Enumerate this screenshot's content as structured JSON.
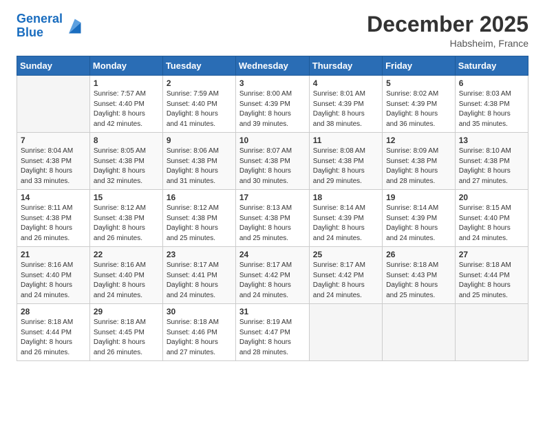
{
  "header": {
    "logo_line1": "General",
    "logo_line2": "Blue",
    "month_title": "December 2025",
    "location": "Habsheim, France"
  },
  "weekdays": [
    "Sunday",
    "Monday",
    "Tuesday",
    "Wednesday",
    "Thursday",
    "Friday",
    "Saturday"
  ],
  "weeks": [
    [
      {
        "day": "",
        "content": ""
      },
      {
        "day": "1",
        "content": "Sunrise: 7:57 AM\nSunset: 4:40 PM\nDaylight: 8 hours\nand 42 minutes."
      },
      {
        "day": "2",
        "content": "Sunrise: 7:59 AM\nSunset: 4:40 PM\nDaylight: 8 hours\nand 41 minutes."
      },
      {
        "day": "3",
        "content": "Sunrise: 8:00 AM\nSunset: 4:39 PM\nDaylight: 8 hours\nand 39 minutes."
      },
      {
        "day": "4",
        "content": "Sunrise: 8:01 AM\nSunset: 4:39 PM\nDaylight: 8 hours\nand 38 minutes."
      },
      {
        "day": "5",
        "content": "Sunrise: 8:02 AM\nSunset: 4:39 PM\nDaylight: 8 hours\nand 36 minutes."
      },
      {
        "day": "6",
        "content": "Sunrise: 8:03 AM\nSunset: 4:38 PM\nDaylight: 8 hours\nand 35 minutes."
      }
    ],
    [
      {
        "day": "7",
        "content": "Sunrise: 8:04 AM\nSunset: 4:38 PM\nDaylight: 8 hours\nand 33 minutes."
      },
      {
        "day": "8",
        "content": "Sunrise: 8:05 AM\nSunset: 4:38 PM\nDaylight: 8 hours\nand 32 minutes."
      },
      {
        "day": "9",
        "content": "Sunrise: 8:06 AM\nSunset: 4:38 PM\nDaylight: 8 hours\nand 31 minutes."
      },
      {
        "day": "10",
        "content": "Sunrise: 8:07 AM\nSunset: 4:38 PM\nDaylight: 8 hours\nand 30 minutes."
      },
      {
        "day": "11",
        "content": "Sunrise: 8:08 AM\nSunset: 4:38 PM\nDaylight: 8 hours\nand 29 minutes."
      },
      {
        "day": "12",
        "content": "Sunrise: 8:09 AM\nSunset: 4:38 PM\nDaylight: 8 hours\nand 28 minutes."
      },
      {
        "day": "13",
        "content": "Sunrise: 8:10 AM\nSunset: 4:38 PM\nDaylight: 8 hours\nand 27 minutes."
      }
    ],
    [
      {
        "day": "14",
        "content": "Sunrise: 8:11 AM\nSunset: 4:38 PM\nDaylight: 8 hours\nand 26 minutes."
      },
      {
        "day": "15",
        "content": "Sunrise: 8:12 AM\nSunset: 4:38 PM\nDaylight: 8 hours\nand 26 minutes."
      },
      {
        "day": "16",
        "content": "Sunrise: 8:12 AM\nSunset: 4:38 PM\nDaylight: 8 hours\nand 25 minutes."
      },
      {
        "day": "17",
        "content": "Sunrise: 8:13 AM\nSunset: 4:38 PM\nDaylight: 8 hours\nand 25 minutes."
      },
      {
        "day": "18",
        "content": "Sunrise: 8:14 AM\nSunset: 4:39 PM\nDaylight: 8 hours\nand 24 minutes."
      },
      {
        "day": "19",
        "content": "Sunrise: 8:14 AM\nSunset: 4:39 PM\nDaylight: 8 hours\nand 24 minutes."
      },
      {
        "day": "20",
        "content": "Sunrise: 8:15 AM\nSunset: 4:40 PM\nDaylight: 8 hours\nand 24 minutes."
      }
    ],
    [
      {
        "day": "21",
        "content": "Sunrise: 8:16 AM\nSunset: 4:40 PM\nDaylight: 8 hours\nand 24 minutes."
      },
      {
        "day": "22",
        "content": "Sunrise: 8:16 AM\nSunset: 4:40 PM\nDaylight: 8 hours\nand 24 minutes."
      },
      {
        "day": "23",
        "content": "Sunrise: 8:17 AM\nSunset: 4:41 PM\nDaylight: 8 hours\nand 24 minutes."
      },
      {
        "day": "24",
        "content": "Sunrise: 8:17 AM\nSunset: 4:42 PM\nDaylight: 8 hours\nand 24 minutes."
      },
      {
        "day": "25",
        "content": "Sunrise: 8:17 AM\nSunset: 4:42 PM\nDaylight: 8 hours\nand 24 minutes."
      },
      {
        "day": "26",
        "content": "Sunrise: 8:18 AM\nSunset: 4:43 PM\nDaylight: 8 hours\nand 25 minutes."
      },
      {
        "day": "27",
        "content": "Sunrise: 8:18 AM\nSunset: 4:44 PM\nDaylight: 8 hours\nand 25 minutes."
      }
    ],
    [
      {
        "day": "28",
        "content": "Sunrise: 8:18 AM\nSunset: 4:44 PM\nDaylight: 8 hours\nand 26 minutes."
      },
      {
        "day": "29",
        "content": "Sunrise: 8:18 AM\nSunset: 4:45 PM\nDaylight: 8 hours\nand 26 minutes."
      },
      {
        "day": "30",
        "content": "Sunrise: 8:18 AM\nSunset: 4:46 PM\nDaylight: 8 hours\nand 27 minutes."
      },
      {
        "day": "31",
        "content": "Sunrise: 8:19 AM\nSunset: 4:47 PM\nDaylight: 8 hours\nand 28 minutes."
      },
      {
        "day": "",
        "content": ""
      },
      {
        "day": "",
        "content": ""
      },
      {
        "day": "",
        "content": ""
      }
    ]
  ]
}
